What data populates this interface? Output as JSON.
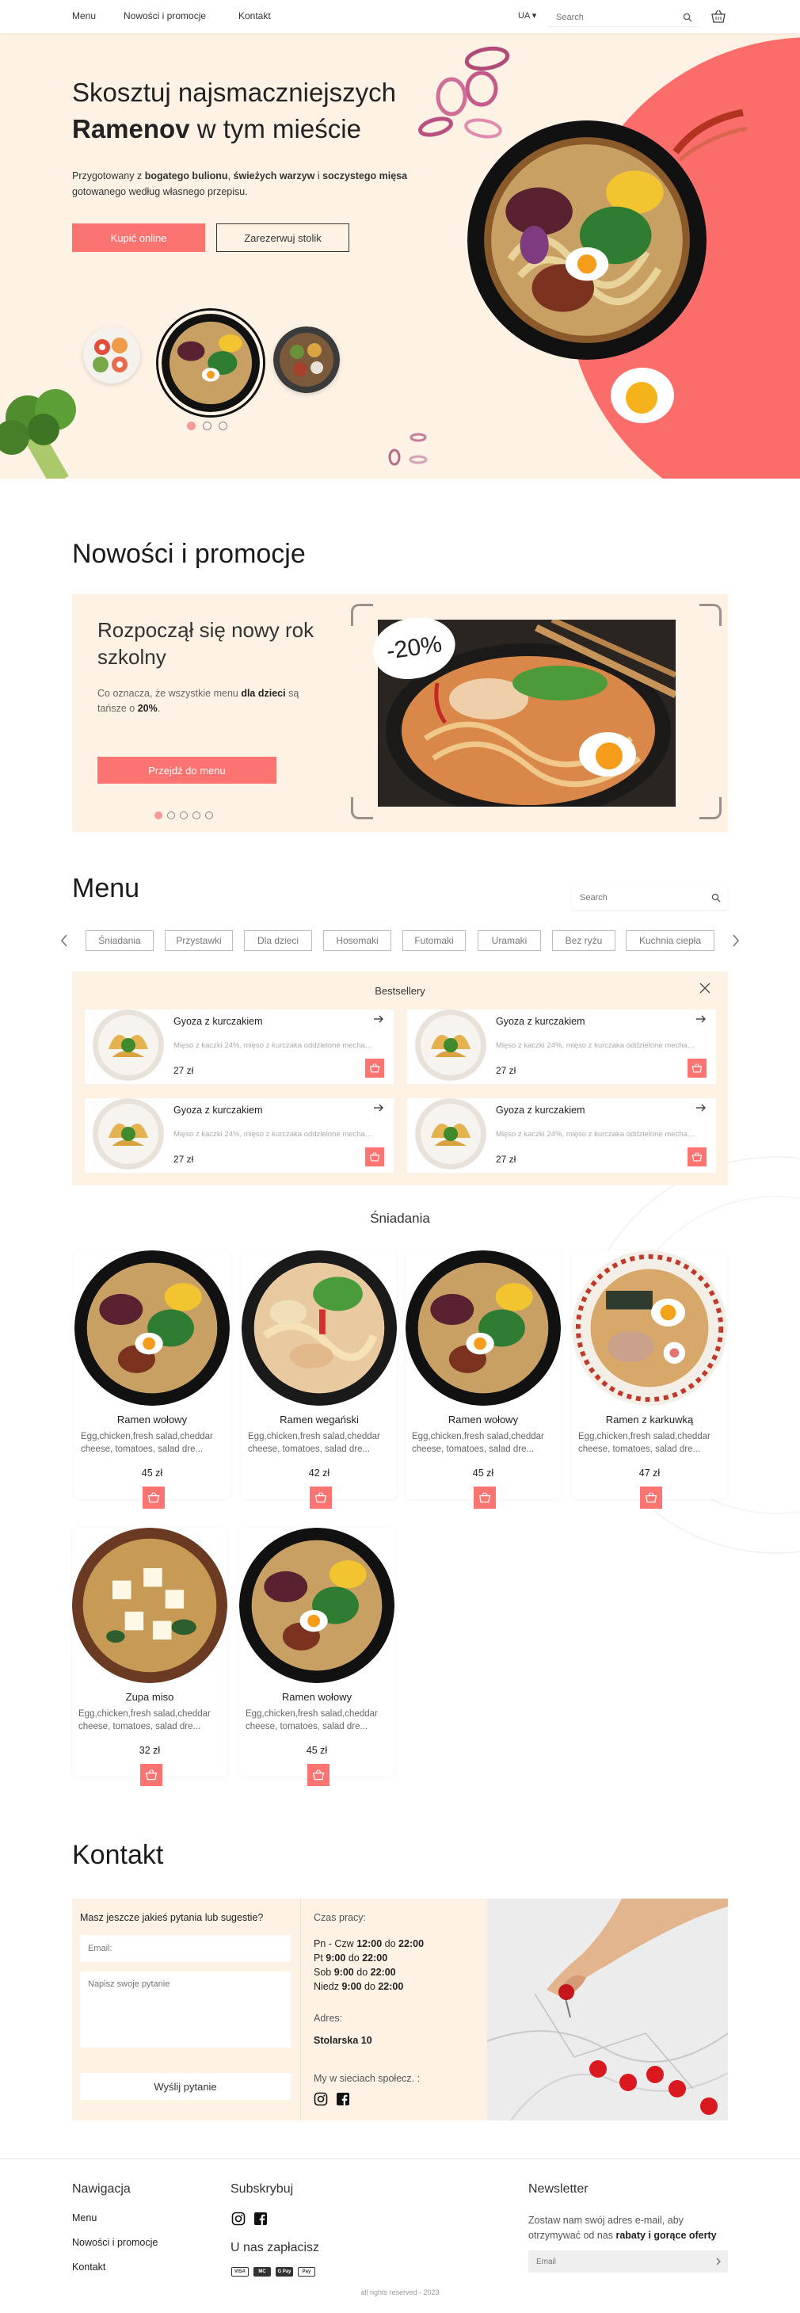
{
  "nav": {
    "links": [
      "Menu",
      "Nowości i promocje",
      "Kontakt"
    ],
    "lang": "UA ▾",
    "search_placeholder": "Search"
  },
  "hero": {
    "title_line1": "Skosztuj najsmaczniejszych",
    "title_bold": "Ramenov",
    "title_rest": " w tym mieście",
    "desc_pre": "Przygotowany z ",
    "desc_b1": "bogatego bulionu",
    "desc_mid1": ", ",
    "desc_b2": "świeżych warzyw",
    "desc_mid2": " i ",
    "desc_b3": "soczystego mięsa",
    "desc_post": " gotowanego według własnego przepisu.",
    "buy_label": "Kupić online",
    "reserve_label": "Zarezerwuj stolik",
    "slides": 3,
    "active_slide": 1
  },
  "news": {
    "heading": "Nowości i promocje",
    "promo_title": "Rozpoczął się nowy rok szkolny",
    "promo_text_pre": "Co oznacza, że wszystkie menu ",
    "promo_text_b1": "dla dzieci",
    "promo_text_mid": " są tańsze o ",
    "promo_text_b2": "20%",
    "promo_text_post": ".",
    "promo_button": "Przejdź do menu",
    "discount": "-20%",
    "slides": 5,
    "active_slide": 1
  },
  "menu": {
    "heading": "Menu",
    "search_placeholder": "Search",
    "categories": [
      "Śniadania",
      "Przystawki",
      "Dla dzieci",
      "Hosomaki",
      "Futomaki",
      "Uramaki",
      "Bez ryżu",
      "Kuchnia ciepła"
    ],
    "bestsellers_title": "Bestsellery",
    "bestsellers": [
      {
        "name": "Gyoza z kurczakiem",
        "desc": "Mięso z kaczki 24%, mięso z kurczaka oddzielone mechan...",
        "price": "27 zł"
      },
      {
        "name": "Gyoza z kurczakiem",
        "desc": "Mięso z kaczki 24%, mięso z kurczaka oddzielone mechan...",
        "price": "27 zł"
      },
      {
        "name": "Gyoza z kurczakiem",
        "desc": "Mięso z kaczki 24%, mięso z kurczaka oddzielone mechan...",
        "price": "27 zł"
      },
      {
        "name": "Gyoza z kurczakiem",
        "desc": "Mięso z kaczki 24%, mięso z kurczaka oddzielone mechan...",
        "price": "27 zł"
      }
    ],
    "category_heading": "Śniadania",
    "dishes": [
      {
        "name": "Ramen  wołowy",
        "desc": "Egg,chicken,fresh salad,cheddar cheese, tomatoes, salad dre...",
        "price": "45 zł",
        "kind": "beef"
      },
      {
        "name": "Ramen  wegański",
        "desc": "Egg,chicken,fresh salad,cheddar cheese, tomatoes, salad dre...",
        "price": "42 zł",
        "kind": "vegan"
      },
      {
        "name": "Ramen  wołowy",
        "desc": "Egg,chicken,fresh salad,cheddar cheese, tomatoes, salad dre...",
        "price": "45 zł",
        "kind": "beef"
      },
      {
        "name": "Ramen z karkuwką",
        "desc": "Egg,chicken,fresh salad,cheddar cheese, tomatoes, salad dre...",
        "price": "47 zł",
        "kind": "pork"
      },
      {
        "name": "Zupa miso",
        "desc": "Egg,chicken,fresh salad,cheddar cheese, tomatoes, salad dre...",
        "price": "32 zł",
        "kind": "miso"
      },
      {
        "name": "Ramen  wołowy",
        "desc": "Egg,chicken,fresh salad,cheddar cheese, tomatoes, salad dre...",
        "price": "45 zł",
        "kind": "beef"
      }
    ]
  },
  "contact": {
    "heading": "Kontakt",
    "form_title": "Masz jeszcze jakieś pytania lub sugestie?",
    "email_placeholder": "Email:",
    "question_placeholder": "Napisz swoje pytanie",
    "send_label": "Wyślij pytanie",
    "hours_label": "Czas pracy:",
    "hours": [
      {
        "day": "Pn - Czw",
        "from": "12:00",
        "to": "22:00"
      },
      {
        "day": "Pt",
        "from": "9:00",
        "to": "22:00"
      },
      {
        "day": "Sob",
        "from": "9:00",
        "to": "22:00"
      },
      {
        "day": "Niedz",
        "from": "9:00",
        "to": "22:00"
      }
    ],
    "hours_sep": "do",
    "address_label": "Adres:",
    "address": "Stolarska 10",
    "social_label": "My w sieciach społecz. :"
  },
  "footer": {
    "nav_title": "Nawigacja",
    "nav_links": [
      "Menu",
      "Nowości i promocje",
      "Kontakt"
    ],
    "subscribe_title": "Subskrybuj",
    "pay_title": "U nas zapłacisz",
    "pay_icons": [
      "VISA",
      "MC",
      "G Pay",
      "Pay"
    ],
    "newsletter_title": "Newsletter",
    "nl_pre": "Zostaw nam swój adres e-mail, aby otrzymywać od nas ",
    "nl_bold": "rabaty i gorące oferty",
    "nl_placeholder": "Email",
    "copyright": "all rights reserved - 2023"
  },
  "colors": {
    "accent": "#fb7472",
    "cream": "#fdf2e4",
    "hero_circle": "#fb6d6a",
    "text": "#1b1b1b"
  }
}
